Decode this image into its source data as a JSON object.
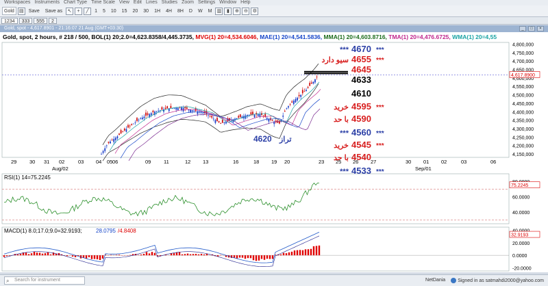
{
  "menu": [
    "Workspaces",
    "Instruments",
    "Chart Type",
    "Time Scale",
    "View",
    "Edit",
    "Lines",
    "Studies",
    "Zoom",
    "Settings",
    "Window",
    "Help"
  ],
  "toolbar": {
    "sym_field": "Gold",
    "save_label": "Save",
    "save_as_label": "Save as",
    "intervals": [
      "1",
      "5",
      "10",
      "15",
      "20",
      "30",
      "1H",
      "4H",
      "8H",
      "D",
      "W",
      "M"
    ]
  },
  "tabs": [
    "1234",
    "333",
    "555",
    "2"
  ],
  "window": {
    "title": "Gold, spot - 4,617.8901 - 21:16:07  21 Aug (GMT+03:30)"
  },
  "info": {
    "main": "Gold, spot, 2 hours, # 218 / 500, BOL(1) 20;2.0=4,623.8358/4,445.3735,",
    "mvg": "MVG(1) 20=4,534.6046,",
    "mae": "MAE(1) 20=4,541.5836,",
    "mma": "MMA(1) 20=4,603.8716,",
    "tma": "TMA(1) 20=4,476.6725,",
    "wma": "WMA(1) 20=4,55"
  },
  "price_axis": [
    "4,800,000",
    "4,750,000",
    "4,700,000",
    "4,650,000",
    "4,600,000",
    "4,550,000",
    "4,500,000",
    "4,450,000",
    "4,400,000",
    "4,350,000",
    "4,300,000",
    "4,250,000",
    "4,200,000",
    "4,150,000"
  ],
  "current_price": "4,617.8900",
  "time_axis": [
    "29",
    "30",
    "31",
    "02",
    "03",
    "04",
    "05",
    "06",
    "09",
    "11",
    "12",
    "13",
    "16",
    "18",
    "19",
    "20",
    "23",
    "25",
    "26",
    "27",
    "30",
    "01",
    "02",
    "03",
    "06"
  ],
  "time_axis_month": [
    "Aug/02",
    "Sep/01"
  ],
  "levels": [
    {
      "text": "4670",
      "color": "#2b3fa6",
      "prefix": "***",
      "suffix": "***"
    },
    {
      "text": "4655",
      "color": "#d81f1f",
      "prefix": "سیو دارد",
      "suffix": "***"
    },
    {
      "text": "4645",
      "color": "#d81f1f",
      "prefix": "",
      "suffix": ""
    },
    {
      "text": "4633",
      "color": "#000000",
      "prefix": "",
      "suffix": ""
    },
    {
      "text": "4610",
      "color": "#000000",
      "prefix": "",
      "suffix": ""
    },
    {
      "text": "4595",
      "color": "#d81f1f",
      "prefix": "خرید",
      "suffix": "***"
    },
    {
      "text": "4590",
      "color": "#d81f1f",
      "prefix": "با حد",
      "suffix": ""
    },
    {
      "text": "4560",
      "color": "#2b3fa6",
      "prefix": "***",
      "suffix": "***"
    },
    {
      "text": "4545",
      "color": "#d81f1f",
      "prefix": "خرید",
      "suffix": "***"
    },
    {
      "text": "4540",
      "color": "#d81f1f",
      "prefix": "با حد",
      "suffix": ""
    },
    {
      "text": "4533",
      "color": "#2b3fa6",
      "prefix": "***",
      "suffix": "***"
    }
  ],
  "taraz_label": {
    "number": "4620",
    "word": "تراز"
  },
  "rsi": {
    "label": "RSI(1) 14=75.2245",
    "value": "75.2245",
    "axis": [
      "80.0000",
      "60.0000",
      "40.0000"
    ]
  },
  "macd": {
    "label_a": "MACD(1) 8.0;17.0;9.0=32.9193;",
    "label_b": "28.0795",
    "label_c": "/4.8408",
    "value": "32.9193",
    "axis": [
      "40.0000",
      "20.0000",
      "0.0000",
      "-20.0000"
    ]
  },
  "status": {
    "find_placeholder": "Search for instrument",
    "brand": "NetDania",
    "signed_in": "Signed in as satmahdi2000@yahoo.com"
  },
  "colors": {
    "bull": "#1a3ec9",
    "bear": "#d01010",
    "band": "#222222",
    "level_blue": "#2b3fa6",
    "level_red": "#d81f1f",
    "rsi": "#2a8f2a",
    "macd_bar": "#e00000",
    "signal": "#1f58c9"
  }
}
